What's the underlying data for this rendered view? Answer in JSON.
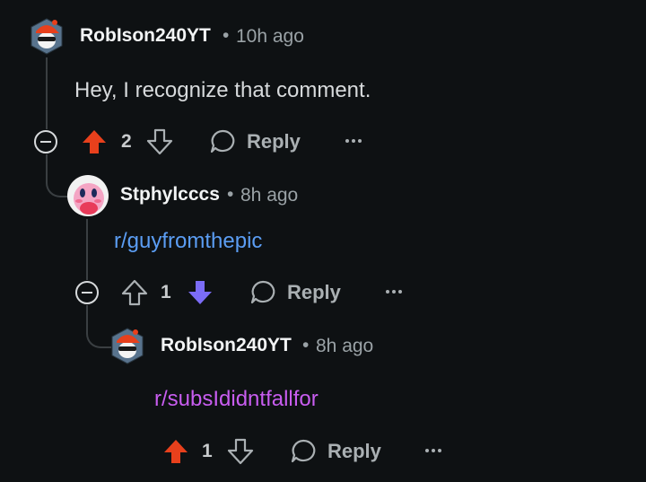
{
  "comments": [
    {
      "username": "RobIson240YT",
      "separator": "•",
      "time": "10h ago",
      "body": "Hey, I recognize that comment.",
      "votes": "2",
      "vote_state": "upvoted",
      "reply_label": "Reply",
      "avatar_icon": "snoo-cap-avatar-icon"
    },
    {
      "username": "Stphylcccs",
      "separator": "•",
      "time": "8h ago",
      "body": "r/guyfromthepic",
      "body_color": "#5b9df3",
      "votes": "1",
      "vote_state": "downvoted",
      "reply_label": "Reply",
      "avatar_icon": "pink-character-avatar-icon"
    },
    {
      "username": "RobIson240YT",
      "separator": "•",
      "time": "8h ago",
      "body": "r/subsIdidntfallfor",
      "body_color": "#c85df0",
      "votes": "1",
      "vote_state": "upvoted",
      "reply_label": "Reply",
      "avatar_icon": "snoo-cap-avatar-icon"
    }
  ],
  "colors": {
    "upvote": "#e8401c",
    "downvote": "#7b6cf6",
    "background": "#0e1113"
  }
}
